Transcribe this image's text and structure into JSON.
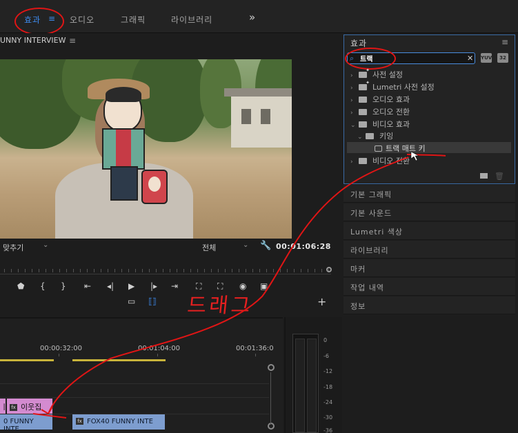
{
  "workspaces": {
    "items": [
      {
        "label": "효과"
      },
      {
        "label": "≡"
      },
      {
        "label": "오디오"
      },
      {
        "label": "그래픽"
      },
      {
        "label": "라이브러리"
      },
      {
        "label": "»"
      }
    ]
  },
  "program": {
    "title": "UNNY INTERVIEW",
    "menu": "≡",
    "fit": "맞추기",
    "quality": "전체",
    "timecode": "00:01:06:28"
  },
  "annotation": {
    "handwritten": "드래그"
  },
  "timeline": {
    "timecodes": [
      "00:00:32:00",
      "00:01:04:00",
      "00:01:36:0"
    ],
    "clip_v2_left": "ㅣ",
    "clip_v2": "이웃집",
    "clip_v1_left": "0 FUNNY INTE",
    "clip_v1": "FOX40 FUNNY INTE",
    "fx_badge": "fx"
  },
  "meter": {
    "labels": [
      "0",
      "-6",
      "-12",
      "-18",
      "-24",
      "-30",
      "-36"
    ]
  },
  "effects_panel": {
    "title": "효과",
    "menu": "≡",
    "search_value": "트랙",
    "search_icon": "search-icon",
    "btn_accelerated": "32",
    "btn_yuv": "YUV",
    "tree": [
      {
        "label": "사전 설정",
        "arrow": "›"
      },
      {
        "label": "Lumetri 사전 설정",
        "arrow": "›"
      },
      {
        "label": "오디오 효과",
        "arrow": "›"
      },
      {
        "label": "오디오 전환",
        "arrow": "›"
      },
      {
        "label": "비디오 효과",
        "arrow": "⌄"
      },
      {
        "label": "키잉",
        "arrow": "⌄"
      },
      {
        "label": "트랙 매트 키"
      },
      {
        "label": "비디오 전환",
        "arrow": "›"
      }
    ]
  },
  "panels": [
    {
      "label": "기본 그래픽"
    },
    {
      "label": "기본 사운드"
    },
    {
      "label": "Lumetri 색상"
    },
    {
      "label": "라이브러리"
    },
    {
      "label": "마커"
    },
    {
      "label": "작업 내역"
    },
    {
      "label": "정보"
    }
  ],
  "colors": {
    "accent": "#3e8cf0",
    "annotation": "#e01515",
    "clip_pink": "#d48bd0",
    "clip_blue": "#7d9dcf"
  }
}
